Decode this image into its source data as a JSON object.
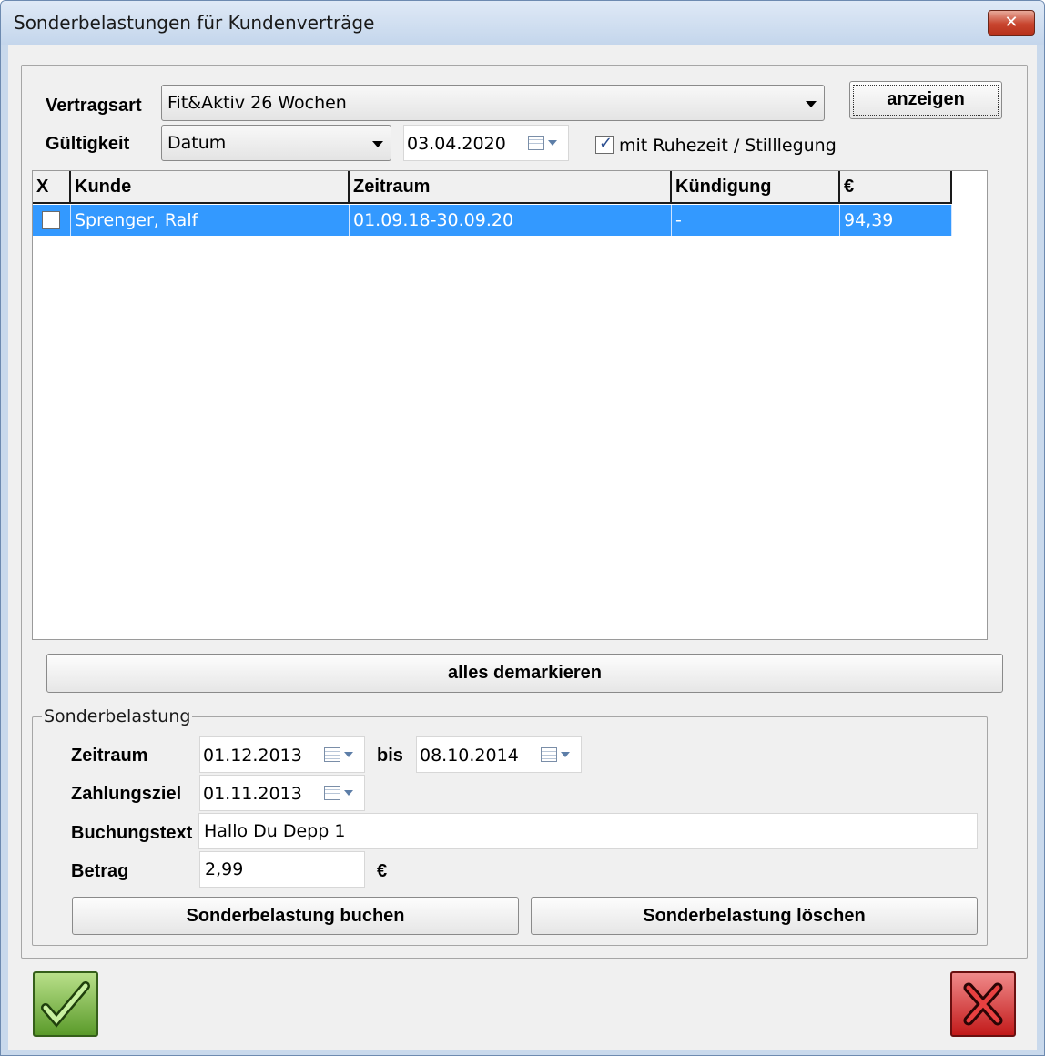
{
  "window": {
    "title": "Sonderbelastungen für Kundenverträge",
    "close_glyph": "✕"
  },
  "filter": {
    "vertragsart_label": "Vertragsart",
    "vertragsart_value": "Fit&Aktiv 26 Wochen",
    "gueltigkeit_label": "Gültigkeit",
    "gueltigkeit_value": "Datum",
    "date_value": "03.04.2020",
    "ruhezeit_label": "mit Ruhezeit / Stilllegung",
    "ruhezeit_checked": true,
    "anzeigen_label": "anzeigen"
  },
  "table": {
    "columns": [
      "X",
      "Kunde",
      "Zeitraum",
      "Kündigung",
      "€"
    ],
    "rows": [
      {
        "checked": true,
        "kunde": "Sprenger, Ralf",
        "zeitraum": "01.09.18-30.09.20",
        "kuendigung": "-",
        "betrag": "94,39"
      }
    ]
  },
  "demark_label": "alles demarkieren",
  "sonderbelastung": {
    "group_title": "Sonderbelastung",
    "zeitraum_label": "Zeitraum",
    "zeitraum_from": "01.12.2013",
    "bis_label": "bis",
    "zeitraum_to": "08.10.2014",
    "zahlungsziel_label": "Zahlungsziel",
    "zahlungsziel_value": "01.11.2013",
    "buchungstext_label": "Buchungstext",
    "buchungstext_value": "Hallo Du Depp 1",
    "betrag_label": "Betrag",
    "betrag_value": "2,99",
    "currency": "€",
    "buchen_label": "Sonderbelastung buchen",
    "loeschen_label": "Sonderbelastung löschen"
  },
  "icons": {
    "ok": "check-icon",
    "cancel": "x-icon",
    "calendar": "calendar-icon"
  },
  "colors": {
    "selection": "#3399ff",
    "ok": "#5a9a2a",
    "cancel": "#c21a1a"
  }
}
